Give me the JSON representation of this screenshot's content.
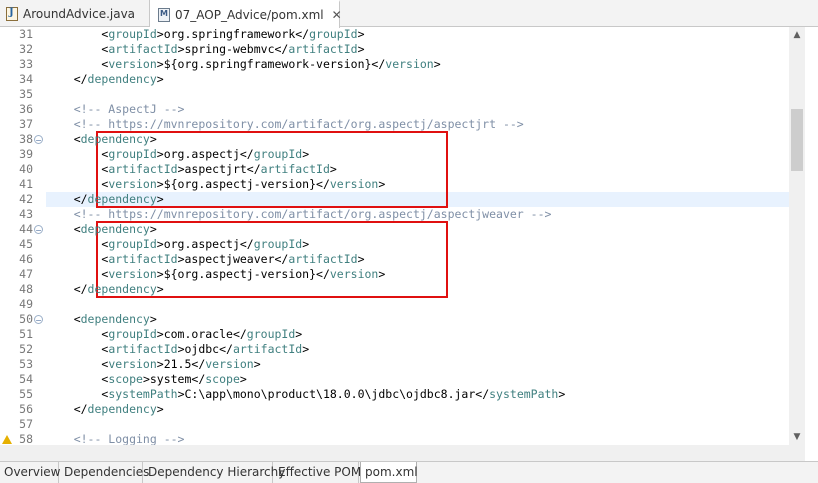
{
  "editor_tabs": [
    {
      "label": "AroundAdvice.java",
      "icon": "java-file-icon",
      "active": false
    },
    {
      "label": "07_AOP_Advice/pom.xml",
      "icon": "maven-pom-icon",
      "active": true,
      "close": "✕"
    }
  ],
  "code_lines": [
    {
      "n": "31",
      "parts": [
        [
          "tx",
          "        <"
        ],
        [
          "tg",
          "groupId"
        ],
        [
          "tx",
          ">org.springframework</"
        ],
        [
          "tg",
          "groupId"
        ],
        [
          "tx",
          ">"
        ]
      ]
    },
    {
      "n": "32",
      "parts": [
        [
          "tx",
          "        <"
        ],
        [
          "tg",
          "artifactId"
        ],
        [
          "tx",
          ">spring-webmvc</"
        ],
        [
          "tg",
          "artifactId"
        ],
        [
          "tx",
          ">"
        ]
      ]
    },
    {
      "n": "33",
      "parts": [
        [
          "tx",
          "        <"
        ],
        [
          "tg",
          "version"
        ],
        [
          "tx",
          ">${org.springframework-version}</"
        ],
        [
          "tg",
          "version"
        ],
        [
          "tx",
          ">"
        ]
      ]
    },
    {
      "n": "34",
      "parts": [
        [
          "tx",
          "    </"
        ],
        [
          "tg",
          "dependency"
        ],
        [
          "tx",
          ">"
        ]
      ]
    },
    {
      "n": "35",
      "parts": []
    },
    {
      "n": "36",
      "parts": [
        [
          "cm",
          "    <!-- AspectJ -->"
        ]
      ]
    },
    {
      "n": "37",
      "parts": [
        [
          "cm",
          "    <!-- https://mvnrepository.com/artifact/org.aspectj/aspectjrt -->"
        ]
      ]
    },
    {
      "n": "38",
      "fold": "−",
      "parts": [
        [
          "tx",
          "    <"
        ],
        [
          "tg",
          "dependency"
        ],
        [
          "tx",
          ">"
        ]
      ]
    },
    {
      "n": "39",
      "parts": [
        [
          "tx",
          "        <"
        ],
        [
          "tg",
          "groupId"
        ],
        [
          "tx",
          ">org.aspectj</"
        ],
        [
          "tg",
          "groupId"
        ],
        [
          "tx",
          ">"
        ]
      ]
    },
    {
      "n": "40",
      "parts": [
        [
          "tx",
          "        <"
        ],
        [
          "tg",
          "artifactId"
        ],
        [
          "tx",
          ">aspectjrt</"
        ],
        [
          "tg",
          "artifactId"
        ],
        [
          "tx",
          ">"
        ]
      ]
    },
    {
      "n": "41",
      "parts": [
        [
          "tx",
          "        <"
        ],
        [
          "tg",
          "version"
        ],
        [
          "tx",
          ">${org.aspectj-version}</"
        ],
        [
          "tg",
          "version"
        ],
        [
          "tx",
          ">"
        ]
      ]
    },
    {
      "n": "42",
      "current": true,
      "parts": [
        [
          "tx",
          "    </"
        ],
        [
          "tg",
          "dependency"
        ],
        [
          "tx",
          ">"
        ]
      ]
    },
    {
      "n": "43",
      "parts": [
        [
          "cm",
          "    <!-- https://mvnrepository.com/artifact/org.aspectj/aspectjweaver -->"
        ]
      ]
    },
    {
      "n": "44",
      "fold": "−",
      "parts": [
        [
          "tx",
          "    <"
        ],
        [
          "tg",
          "dependency"
        ],
        [
          "tx",
          ">"
        ]
      ]
    },
    {
      "n": "45",
      "parts": [
        [
          "tx",
          "        <"
        ],
        [
          "tg",
          "groupId"
        ],
        [
          "tx",
          ">org.aspectj</"
        ],
        [
          "tg",
          "groupId"
        ],
        [
          "tx",
          ">"
        ]
      ]
    },
    {
      "n": "46",
      "parts": [
        [
          "tx",
          "        <"
        ],
        [
          "tg",
          "artifactId"
        ],
        [
          "tx",
          ">aspectjweaver</"
        ],
        [
          "tg",
          "artifactId"
        ],
        [
          "tx",
          ">"
        ]
      ]
    },
    {
      "n": "47",
      "parts": [
        [
          "tx",
          "        <"
        ],
        [
          "tg",
          "version"
        ],
        [
          "tx",
          ">${org.aspectj-version}</"
        ],
        [
          "tg",
          "version"
        ],
        [
          "tx",
          ">"
        ]
      ]
    },
    {
      "n": "48",
      "parts": [
        [
          "tx",
          "    </"
        ],
        [
          "tg",
          "dependency"
        ],
        [
          "tx",
          ">"
        ]
      ]
    },
    {
      "n": "49",
      "parts": []
    },
    {
      "n": "50",
      "fold": "−",
      "parts": [
        [
          "tx",
          "    <"
        ],
        [
          "tg",
          "dependency"
        ],
        [
          "tx",
          ">"
        ]
      ]
    },
    {
      "n": "51",
      "parts": [
        [
          "tx",
          "        <"
        ],
        [
          "tg",
          "groupId"
        ],
        [
          "tx",
          ">com.oracle</"
        ],
        [
          "tg",
          "groupId"
        ],
        [
          "tx",
          ">"
        ]
      ]
    },
    {
      "n": "52",
      "parts": [
        [
          "tx",
          "        <"
        ],
        [
          "tg",
          "artifactId"
        ],
        [
          "tx",
          ">ojdbc</"
        ],
        [
          "tg",
          "artifactId"
        ],
        [
          "tx",
          ">"
        ]
      ]
    },
    {
      "n": "53",
      "parts": [
        [
          "tx",
          "        <"
        ],
        [
          "tg",
          "version"
        ],
        [
          "tx",
          ">21.5</"
        ],
        [
          "tg",
          "version"
        ],
        [
          "tx",
          ">"
        ]
      ]
    },
    {
      "n": "54",
      "parts": [
        [
          "tx",
          "        <"
        ],
        [
          "tg",
          "scope"
        ],
        [
          "tx",
          ">system</"
        ],
        [
          "tg",
          "scope"
        ],
        [
          "tx",
          ">"
        ]
      ]
    },
    {
      "n": "55",
      "parts": [
        [
          "tx",
          "        <"
        ],
        [
          "tg",
          "systemPath"
        ],
        [
          "tx",
          ">C:\\app\\mono\\product\\18.0.0\\jdbc\\ojdbc8.jar</"
        ],
        [
          "tg",
          "systemPath"
        ],
        [
          "tx",
          ">"
        ]
      ]
    },
    {
      "n": "56",
      "parts": [
        [
          "tx",
          "    </"
        ],
        [
          "tg",
          "dependency"
        ],
        [
          "tx",
          ">"
        ]
      ]
    },
    {
      "n": "57",
      "parts": []
    },
    {
      "n": "58",
      "warning": true,
      "parts": [
        [
          "cm",
          "    <!-- Logging -->"
        ]
      ]
    }
  ],
  "bottom_tabs": [
    {
      "label": "Overview",
      "active": false
    },
    {
      "label": "Dependencies",
      "active": false
    },
    {
      "label": "Dependency Hierarchy",
      "active": false
    },
    {
      "label": "Effective POM",
      "active": false
    },
    {
      "label": "pom.xml",
      "active": true
    }
  ],
  "scrollbar": {
    "up": "▲",
    "down": "▼"
  },
  "colors": {
    "tag": "#3f7f7f",
    "comment": "#7f8fa6",
    "highlight_box": "#e01010",
    "current_line": "#e8f2fe"
  }
}
